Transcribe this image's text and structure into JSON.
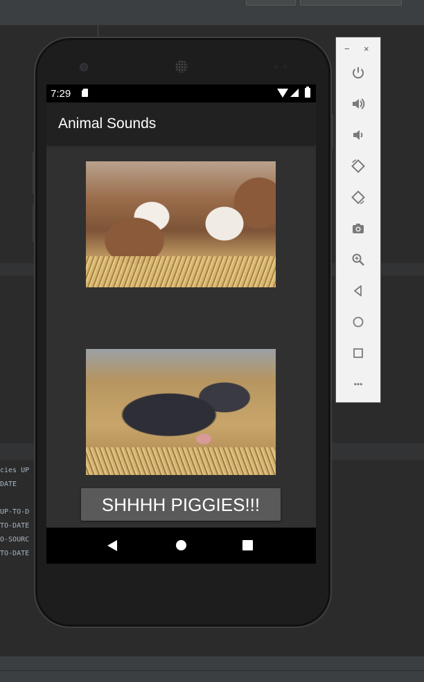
{
  "ide": {
    "console_lines": [
      "cies UP",
      "DATE",
      "",
      "UP-TO-D",
      "TO-DATE",
      "O-SOURC",
      "TO-DATE"
    ]
  },
  "status_bar": {
    "time": "7:29",
    "icons": [
      "sd-card-icon",
      "wifi-icon",
      "signal-icon",
      "battery-icon"
    ]
  },
  "app": {
    "title": "Animal Sounds",
    "images": [
      {
        "name": "cows-image",
        "icon": "cows-photo"
      },
      {
        "name": "pigs-image",
        "icon": "pigs-photo"
      }
    ],
    "button_label": "SHHHH PIGGIES!!!"
  },
  "navigation": {
    "icons": [
      "back-icon",
      "home-icon",
      "recents-icon"
    ]
  },
  "emulator_toolbar": {
    "minimize": "−",
    "close": "×",
    "tools": [
      "power-icon",
      "volume-up-icon",
      "volume-down-icon",
      "rotate-left-icon",
      "rotate-right-icon",
      "camera-icon",
      "zoom-icon",
      "back-icon",
      "home-icon",
      "overview-icon",
      "more-icon"
    ],
    "more_label": "•••"
  }
}
